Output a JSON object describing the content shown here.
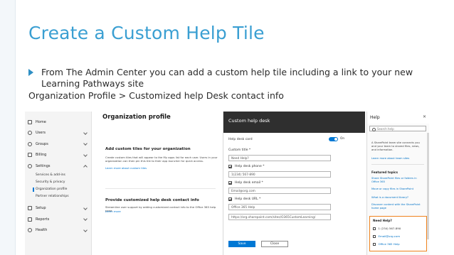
{
  "slide": {
    "title": "Create a Custom Help Tile",
    "bullet": "From The Admin Center you can add a custom help tile including a link to your new Learning Pathways site",
    "subline": "Organization Profile > Customized help Desk contact info"
  },
  "admin_nav": {
    "items": [
      {
        "label": "Home",
        "icon": "home-icon"
      },
      {
        "label": "Users",
        "icon": "user-icon"
      },
      {
        "label": "Groups",
        "icon": "groups-icon"
      },
      {
        "label": "Billing",
        "icon": "billing-icon"
      },
      {
        "label": "Settings",
        "icon": "gear-icon"
      }
    ],
    "settings_sub": [
      "Services & add-ins",
      "Security & privacy",
      "Organization profile",
      "Partner relationships"
    ],
    "more_items": [
      {
        "label": "Setup",
        "icon": "wrench-icon"
      },
      {
        "label": "Reports",
        "icon": "chart-icon"
      },
      {
        "label": "Health",
        "icon": "heart-icon"
      }
    ]
  },
  "org_profile": {
    "title": "Organization profile",
    "section1_heading": "Add custom tiles for your organization",
    "section1_text": "Create custom tiles that will appear to the My apps list for each user. Users in your organization can then pin this tile to their app launcher for quick access.",
    "section1_link": "Learn more about custom tiles",
    "section2_heading": "Provide customized help desk contact info",
    "section2_text": "Streamline user support by adding customized contact info to the Office 365 help pane.",
    "section2_link": "Learn more"
  },
  "dialog": {
    "title": "Custom help desk",
    "help_desk_card_label": "Help desk card",
    "toggle_label": "On",
    "custom_title_label": "Custom title *",
    "custom_title_value": "Need Help?",
    "phone_label": "Help desk phone *",
    "phone_value": "1(234) 567-890",
    "email_label": "Help desk email *",
    "email_value": "Email@org.com",
    "url_label": "Help desk URL *",
    "url_title_value": "Office 365 Help",
    "url_value": "https://org.sharepoint.com/sites/O365CustomLearning/",
    "save_label": "Save",
    "close_label": "Close"
  },
  "help_pane": {
    "title": "Help",
    "search_placeholder": "Search help",
    "intro": "A SharePoint team site connects you and your team to shared files, news, and information.",
    "learn_link": "Learn more about team sites",
    "featured_heading": "Featured topics",
    "topics": [
      "Share SharePoint files or folders in Office 365",
      "Move or copy files in SharePoint",
      "What is a document library?",
      "Discover content with the SharePoint home page"
    ],
    "need_help_title": "Need Help?",
    "need_help_phone": "1 (234) 567-890",
    "need_help_email": "Email@org.com",
    "need_help_link": "Office 365 Help"
  }
}
